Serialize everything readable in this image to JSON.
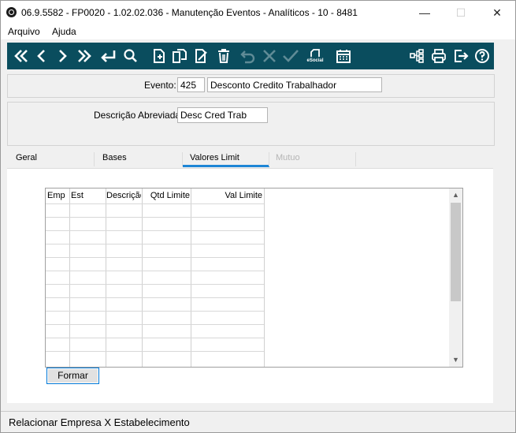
{
  "window": {
    "title": "06.9.5582 - FP0020 - 1.02.02.036 - Manutenção Eventos - Analíticos - 10 - 8481",
    "minimize": "—",
    "maximize": "☐",
    "close": "✕"
  },
  "menu": [
    "Arquivo",
    "Ajuda"
  ],
  "toolbar": {
    "icons": [
      "first-record-icon",
      "previous-record-icon",
      "next-record-icon",
      "last-record-icon",
      "enter-icon",
      "search-icon",
      "new-document-icon",
      "copy-icon",
      "edit-document-icon",
      "delete-icon",
      "undo-icon",
      "cancel-icon",
      "confirm-icon",
      "esocial-icon",
      "calendar-icon",
      "tree-structure-icon",
      "print-icon",
      "exit-icon",
      "help-icon"
    ],
    "esocial_label": "eSocial",
    "color": "#0a4d5e"
  },
  "evento": {
    "label": "Evento:",
    "code": "425",
    "description": "Desconto Credito Trabalhador"
  },
  "descricao": {
    "label": "Descrição Abreviada:",
    "value": "Desc Cred Trab"
  },
  "tabs": [
    {
      "label": "Geral",
      "active": false,
      "disabled": false
    },
    {
      "label": "Bases",
      "active": false,
      "disabled": false
    },
    {
      "label": "Valores Limit",
      "active": true,
      "disabled": false
    },
    {
      "label": "Mutuo",
      "active": false,
      "disabled": true
    }
  ],
  "grid": {
    "columns": [
      "Emp",
      "Est",
      "Descrição",
      "Qtd Limite",
      "Val Limite"
    ],
    "rows": 12
  },
  "formar_button": "Formar",
  "status": "Relacionar Empresa X Estabelecimento",
  "accent_color": "#1e86d6"
}
